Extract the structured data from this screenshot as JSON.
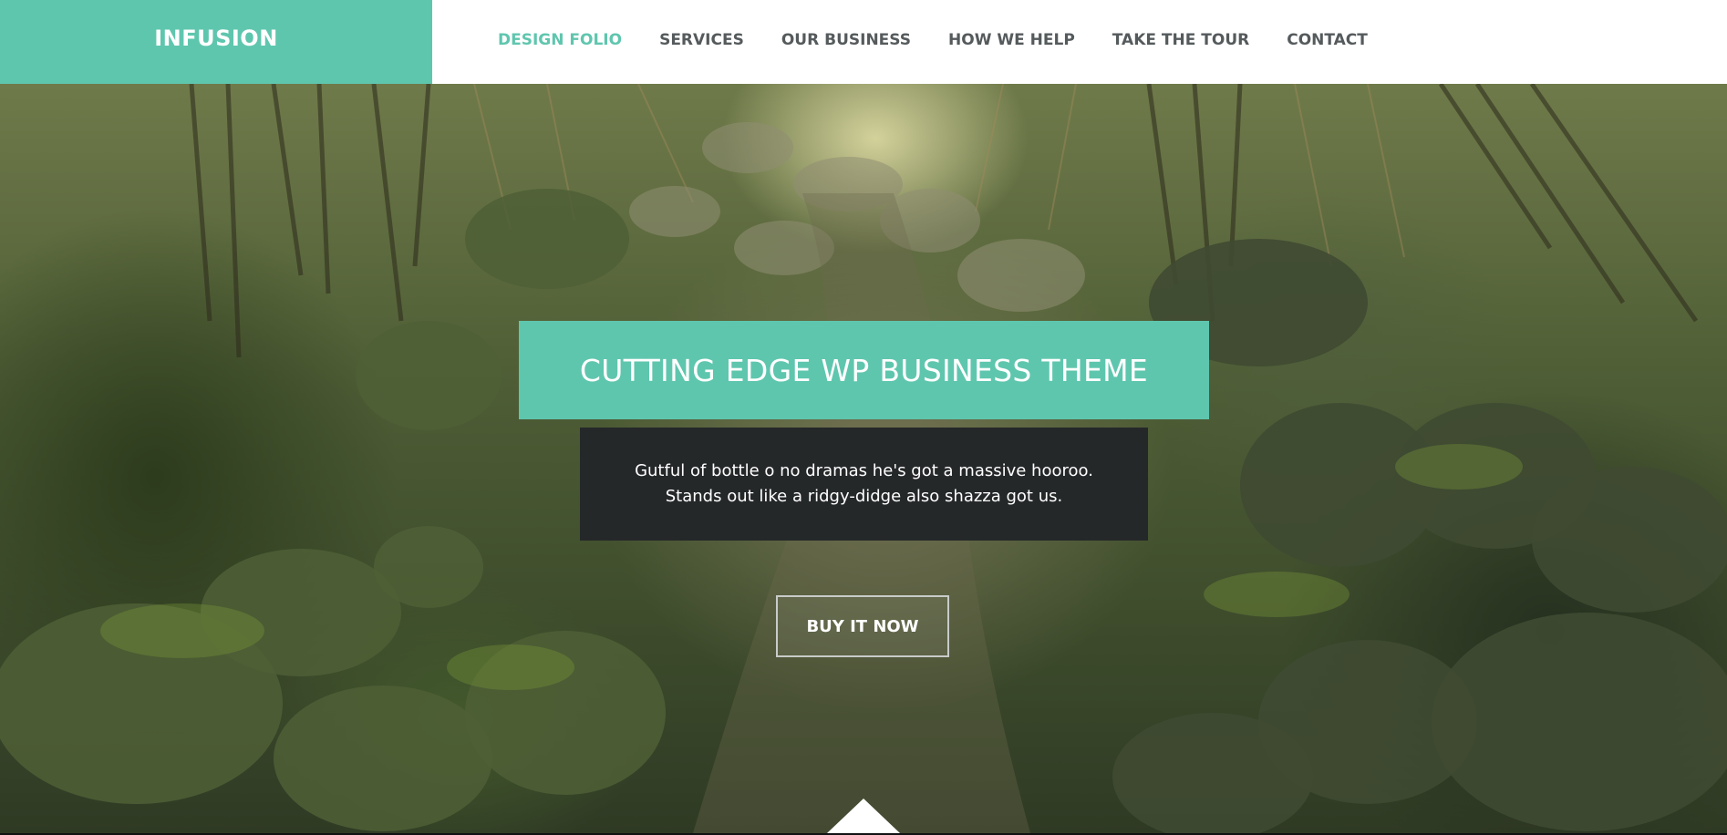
{
  "header": {
    "logo": "INFUSION",
    "nav": [
      {
        "label": "DESIGN FOLIO",
        "active": true
      },
      {
        "label": "SERVICES",
        "active": false
      },
      {
        "label": "OUR BUSINESS",
        "active": false
      },
      {
        "label": "HOW WE HELP",
        "active": false
      },
      {
        "label": "TAKE THE TOUR",
        "active": false
      },
      {
        "label": "CONTACT",
        "active": false
      }
    ]
  },
  "hero": {
    "headline": "CUTTING EDGE WP BUSINESS THEME",
    "description_lines": [
      "Gutful of bottle o no dramas he's got a massive hooroo.",
      "Stands out like a ridgy-didge also shazza got us."
    ],
    "cta_label": "BUY IT NOW",
    "scroll_indicator_icon": "triangle-up-icon"
  },
  "colors": {
    "accent": "#5fc6ae",
    "nav_text": "#555a5c",
    "dark_panel": "#252829",
    "header_bg": "#ffffff"
  }
}
